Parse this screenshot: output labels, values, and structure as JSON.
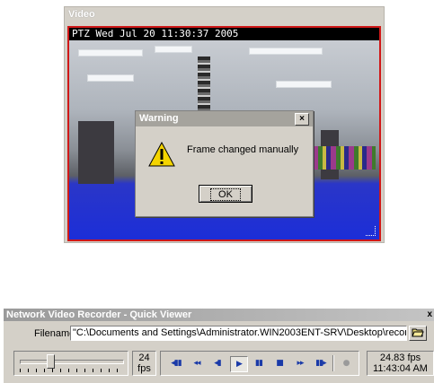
{
  "video": {
    "title": "Video",
    "osd_text": "PTZ  Wed Jul 20  11:30:37  2005"
  },
  "dialog": {
    "title": "Warning",
    "close_label": "×",
    "message": "Frame changed manually",
    "ok_label": "OK"
  },
  "viewer": {
    "title": "Network Video Recorder - Quick Viewer",
    "close_label": "x",
    "filename_label": "Filename:",
    "filename_value": "\"C:\\Documents and Settings\\Administrator.WIN2003ENT-SRV\\Desktop\\recorc",
    "browse_icon": "folder-open-icon",
    "slider_position": 0.28,
    "fps_value": "24",
    "fps_unit": "fps",
    "controls": {
      "skip_start": "◂▮▮",
      "rewind": "◂◂",
      "step_back": "◂▮",
      "play": "▶",
      "pause": "▮▮",
      "stop": "■",
      "fast_forward": "▸▸",
      "skip_end": "▮▮▸",
      "record": "●"
    },
    "playback_fps": "24.83 fps",
    "playback_time": "11:43:04 AM"
  },
  "colors": {
    "video_border": "#d01818",
    "control_blue": "#1a3aa8",
    "dialog_bg": "#d4d0c8"
  }
}
